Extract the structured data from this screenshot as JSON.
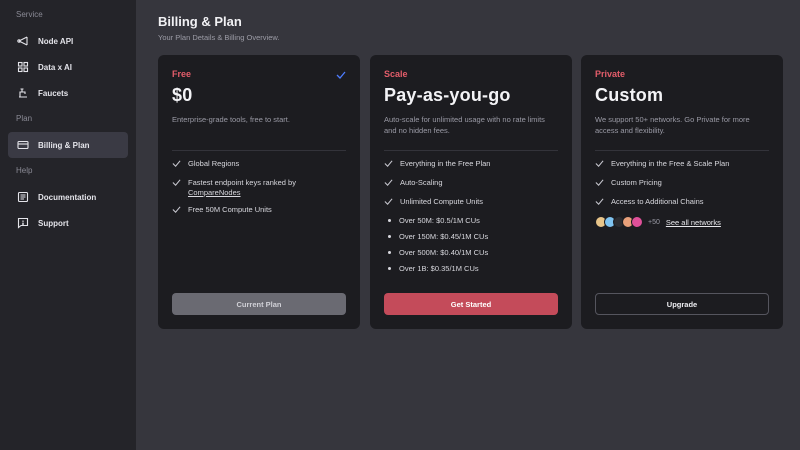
{
  "sidebar": {
    "sections": [
      {
        "label": "Service",
        "items": [
          {
            "label": "Node API",
            "icon": "node-api-icon"
          },
          {
            "label": "Data x AI",
            "icon": "data-ai-icon"
          },
          {
            "label": "Faucets",
            "icon": "faucet-icon"
          }
        ]
      },
      {
        "label": "Plan",
        "items": [
          {
            "label": "Billing & Plan",
            "icon": "billing-card-icon",
            "active": true
          }
        ]
      },
      {
        "label": "Help",
        "items": [
          {
            "label": "Documentation",
            "icon": "document-icon"
          },
          {
            "label": "Support",
            "icon": "support-icon"
          }
        ]
      }
    ]
  },
  "header": {
    "title": "Billing & Plan",
    "subtitle": "Your Plan Details & Billing Overview."
  },
  "colors": {
    "free_accent": "#e35d6a",
    "scale_accent": "#e35d6a",
    "private_accent": "#e35d6a",
    "check_blue": "#4d7cff",
    "primary_button": "#c44b5a"
  },
  "plans": {
    "free": {
      "tier": "Free",
      "price": "$0",
      "description": "Enterprise-grade tools, free to start.",
      "features": [
        "Global Regions",
        "Fastest endpoint keys ranked by",
        "Free 50M Compute Units"
      ],
      "feature_link": "CompareNodes",
      "button": "Current Plan"
    },
    "scale": {
      "tier": "Scale",
      "price": "Pay-as-you-go",
      "description": "Auto-scale for unlimited usage with no rate limits and no hidden fees.",
      "features": [
        "Everything in the Free Plan",
        "Auto-Scaling",
        "Unlimited Compute Units"
      ],
      "pricing": [
        "Over 50M: $0.5/1M CUs",
        "Over 150M: $0.45/1M CUs",
        "Over 500M: $0.40/1M CUs",
        "Over 1B: $0.35/1M CUs"
      ],
      "button": "Get Started"
    },
    "private": {
      "tier": "Private",
      "price": "Custom",
      "description": "We support 50+ networks. Go Private for more access and flexibility.",
      "features": [
        "Everything in the Free & Scale Plan",
        "Custom Pricing",
        "Access to Additional Chains"
      ],
      "networks_more": "+50",
      "networks_link": "See all networks",
      "button": "Upgrade"
    }
  }
}
